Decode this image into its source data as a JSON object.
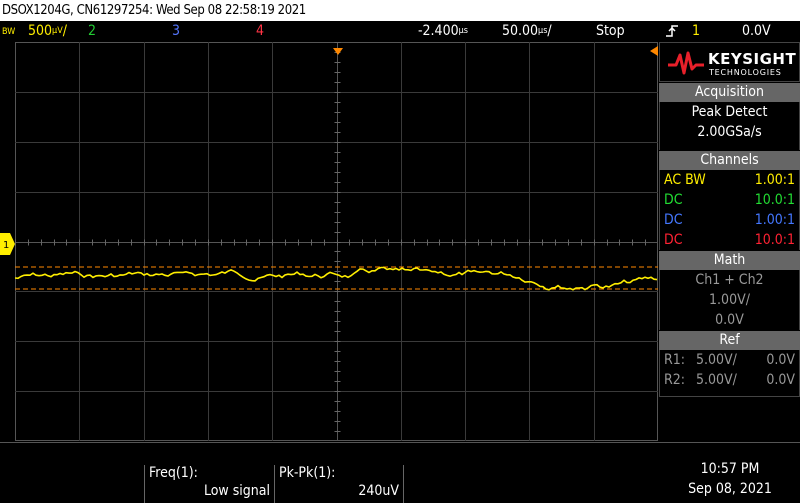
{
  "title_bar": {
    "text": "DSOX1204G, CN61297254: Wed Sep 08 22:58:19 2021"
  },
  "status": {
    "bw_label": "BW",
    "ch1_scale": "500ℤ/",
    "ch2_label": "2",
    "ch3_label": "3",
    "ch4_label": "4",
    "trigger_position": "-2.400s",
    "time_scale": "50.00s/",
    "run_state": "Stop",
    "trigger_source": "1",
    "trigger_level": "0.0V"
  },
  "logo": {
    "word": "KEYSIGHT",
    "sub": "TECHNOLOGIES"
  },
  "acquisition": {
    "header": "Acquisition",
    "mode": "Peak Detect",
    "rate": "2.00GSa/s"
  },
  "channels": {
    "header": "Channels",
    "items": [
      {
        "coupling": "AC BW",
        "probe": "1.00:1",
        "color": "#ffee00"
      },
      {
        "coupling": "DC",
        "probe": "10.0:1",
        "color": "#22dd33"
      },
      {
        "coupling": "DC",
        "probe": "1.00:1",
        "color": "#4477ff"
      },
      {
        "coupling": "DC",
        "probe": "10.0:1",
        "color": "#ff2233"
      }
    ]
  },
  "math": {
    "header": "Math",
    "function": "Ch1 + Ch2",
    "scale": "1.00V/",
    "offset": "0.0V"
  },
  "ref": {
    "header": "Ref",
    "items": [
      {
        "name": "R1:",
        "scale": "5.00V/",
        "offset": "0.0V"
      },
      {
        "name": "R2:",
        "scale": "5.00V/",
        "offset": "0.0V"
      }
    ]
  },
  "measurements": [
    {
      "name": "Freq(1):",
      "value": "Low signal"
    },
    {
      "name": "Pk-Pk(1):",
      "value": "240uV"
    }
  ],
  "clock": {
    "time": "10:57 PM",
    "date": "Sep 08, 2021"
  },
  "colors": {
    "ch1": "#ffee00",
    "grid": "#3a3a3a",
    "cursor": "#ff8800"
  }
}
